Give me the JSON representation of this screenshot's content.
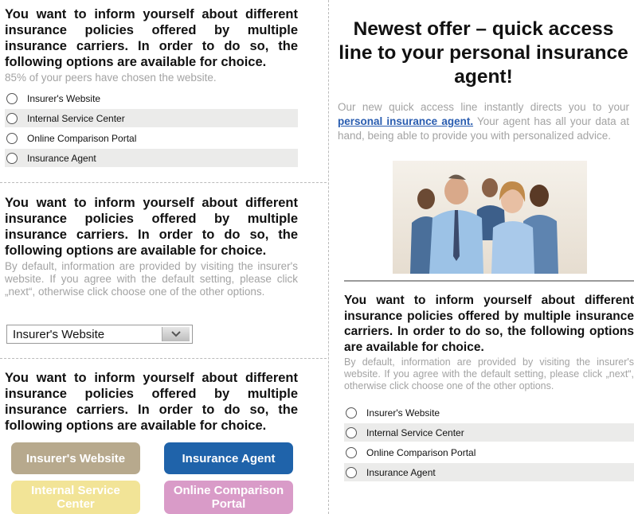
{
  "question": "You want to inform yourself about different insurance policies offered by multiple insurance carriers. In order to do so, the following options are available for choice.",
  "panel1": {
    "note": "85% of your peers have chosen the website.",
    "options": [
      "Insurer's Website",
      "Internal Service Center",
      "Online Comparison Portal",
      "Insurance Agent"
    ]
  },
  "panel2": {
    "note": "By default, information are provided by visiting the insurer's website. If you agree with the default setting, please click „next“, otherwise click choose one of the other options.",
    "select_value": "Insurer's Website"
  },
  "panel3": {
    "buttons": [
      {
        "label": "Insurer's Website",
        "color": "#b7a98d"
      },
      {
        "label": "Insurance Agent",
        "color": "#1f63aa"
      },
      {
        "label": "Internal Service Center",
        "color": "#f2e497"
      },
      {
        "label": "Online Comparison Portal",
        "color": "#d99bc8"
      }
    ]
  },
  "offer": {
    "title": "Newest offer – quick access line to your personal insurance agent!",
    "text_before": "Our new quick access line instantly directs you to your ",
    "link": "personal insurance agent.",
    "text_after": " Your agent has all your data at hand, being able to provide you with personalized advice."
  },
  "panel4": {
    "note": "By default, information are provided by visiting the insurer's website. If you agree with the default setting, please click „next“, otherwise click choose one of the other options.",
    "options": [
      "Insurer's Website",
      "Internal Service Center",
      "Online Comparison Portal",
      "Insurance Agent"
    ]
  }
}
